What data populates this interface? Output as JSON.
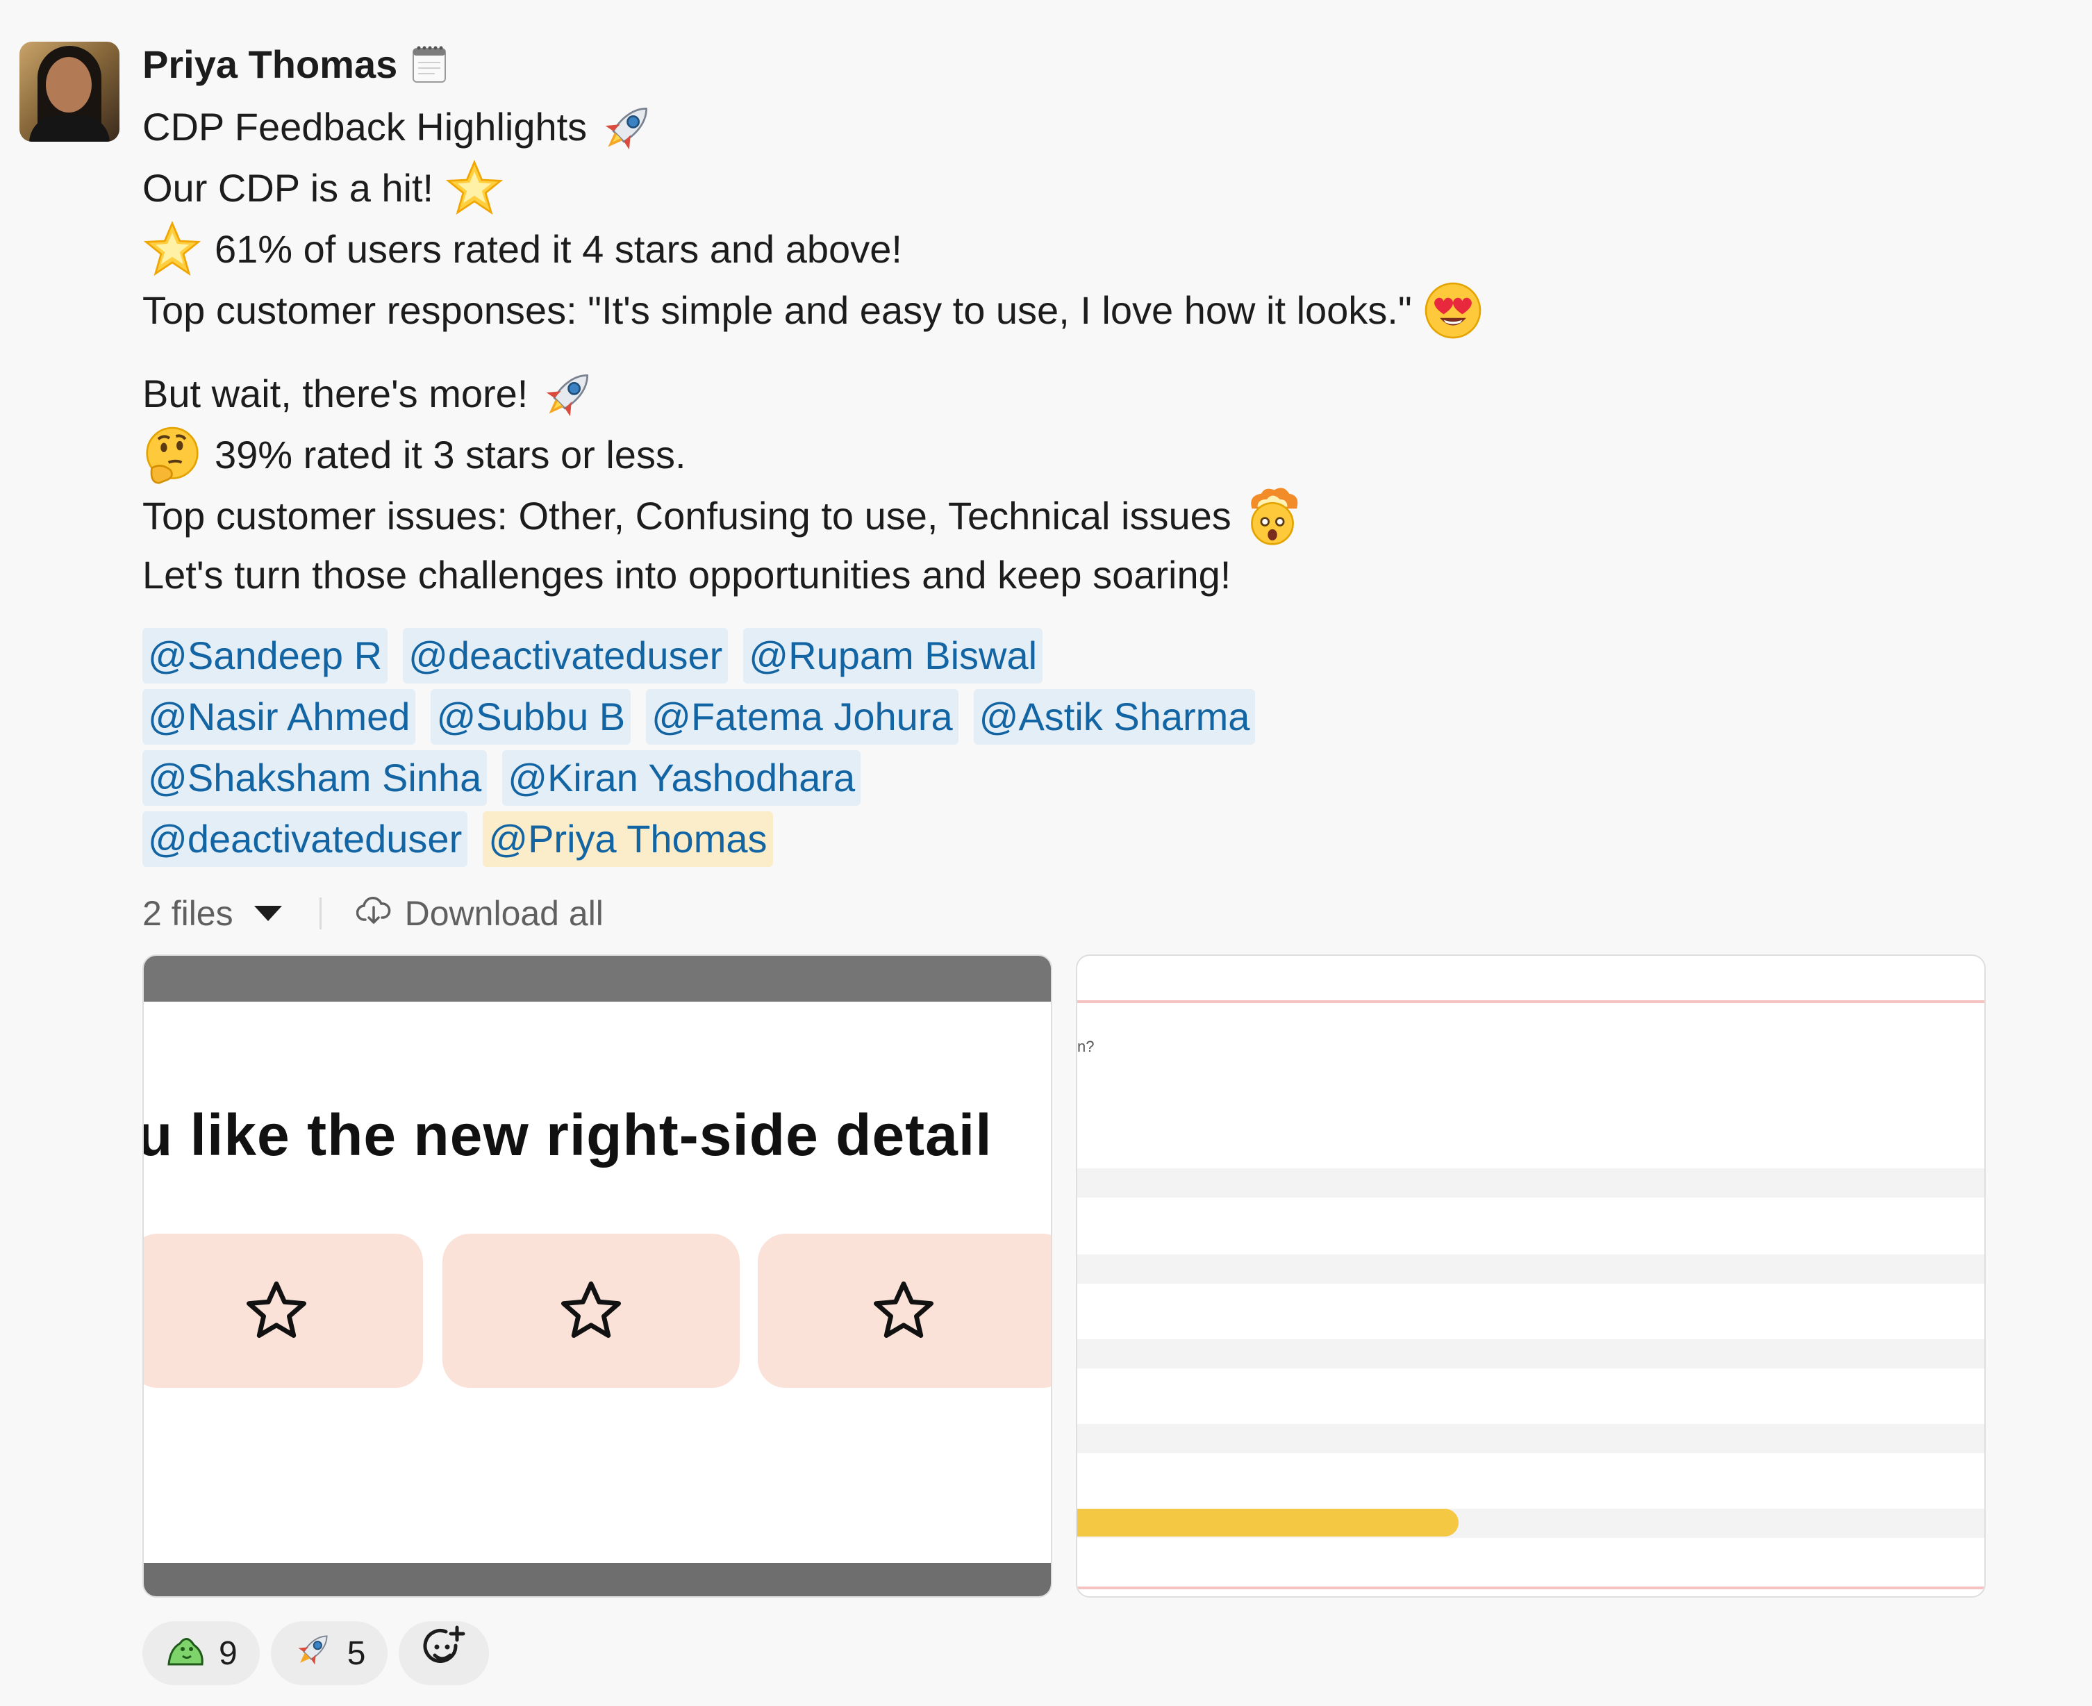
{
  "author": {
    "name": "Priya Thomas",
    "status_icon": "notepad-icon"
  },
  "message": {
    "title": "CDP Feedback Highlights",
    "line1": "Our CDP is a hit!",
    "line2": "61% of users rated it 4 stars and above!",
    "line3": "Top customer responses: \"It's simple and easy to use, I love how it looks.\"",
    "line4": "But wait, there's more!",
    "line5": "39% rated it 3 stars or less.",
    "line6": "Top customer issues: Other, Confusing to use, Technical issues",
    "line7": "Let's turn those challenges into opportunities and keep soaring!"
  },
  "mentions": {
    "row1": [
      "@Sandeep R",
      "@deactivateduser",
      "@Rupam Biswal"
    ],
    "row2": [
      "@Nasir Ahmed",
      "@Subbu B",
      "@Fatema Johura",
      "@Astik Sharma"
    ],
    "row3": [
      "@Shaksham Sinha",
      "@Kiran Yashodhara"
    ],
    "row4": [
      "@deactivateduser",
      "@Priya Thomas"
    ]
  },
  "files": {
    "count_label": "2 files",
    "download_label": "Download all",
    "thumb1_text": "u like the new right-side detail",
    "thumb2_fragment": "n?",
    "thumb2_progress": 0.42
  },
  "reactions": [
    {
      "icon": "party-blob-icon",
      "count": "9"
    },
    {
      "icon": "rocket-icon",
      "count": "5"
    }
  ],
  "colors": {
    "mention": "#1264a3",
    "mention_bg": "#e3eef7",
    "self_mention_bg": "#fbedc9",
    "star_card": "#fbe2d8",
    "progress": "#f4c842"
  }
}
